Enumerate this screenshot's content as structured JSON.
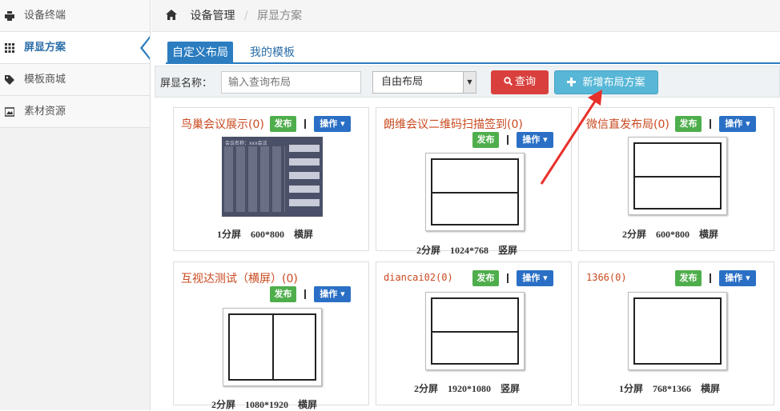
{
  "sidebar": {
    "items": [
      {
        "label": "设备终端",
        "icon": "printer-icon"
      },
      {
        "label": "屏显方案",
        "icon": "grid-icon",
        "active": true
      },
      {
        "label": "模板商城",
        "icon": "tag-icon"
      },
      {
        "label": "素材资源",
        "icon": "image-icon"
      }
    ]
  },
  "breadcrumb": {
    "icon": "home-icon",
    "items": [
      "设备管理",
      "屏显方案"
    ]
  },
  "tabs": [
    "自定义布局",
    "我的模板"
  ],
  "toolbar": {
    "label": "屏显名称：",
    "search_placeholder": "输入查询布局",
    "select_value": "自由布局",
    "query_label": "查询",
    "add_label": "新增布局方案"
  },
  "card_buttons": {
    "publish": "发布",
    "operate": "操作"
  },
  "cards": [
    {
      "name": "鸟巢会议展示(0)",
      "screens": "1分屏",
      "resolution": "600*800",
      "orientation": "横屏"
    },
    {
      "name": "朗维会议二维码扫描签到(0)",
      "screens": "2分屏",
      "resolution": "1024*768",
      "orientation": "竖屏"
    },
    {
      "name": "微信直发布局(0)",
      "screens": "2分屏",
      "resolution": "600*800",
      "orientation": "横屏"
    },
    {
      "name": "互视达测试（横屏）(0)",
      "screens": "2分屏",
      "resolution": "1080*1920",
      "orientation": "横屏"
    },
    {
      "name": "diancai02(0)",
      "screens": "2分屏",
      "resolution": "1920*1080",
      "orientation": "竖屏"
    },
    {
      "name": "1366(0)",
      "screens": "1分屏",
      "resolution": "768*1366",
      "orientation": "横屏"
    }
  ],
  "photo_thumb": {
    "title": "会议名称：xxx会议"
  },
  "colors": {
    "accent": "#2b7dc0",
    "danger": "#d9403d",
    "info": "#58b7d7",
    "success": "#4fae4c",
    "annotation_arrow": "#e8302a"
  }
}
